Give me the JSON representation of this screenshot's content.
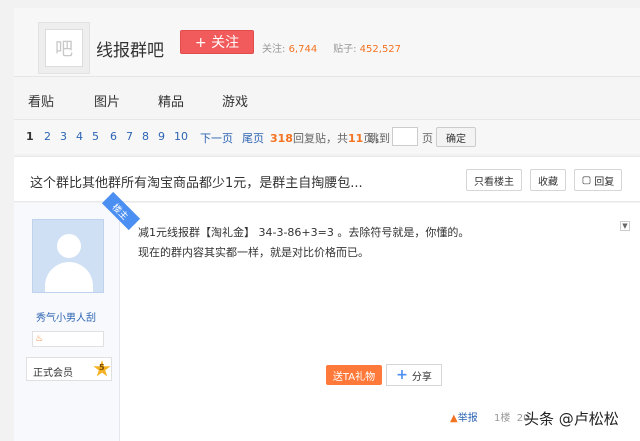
{
  "header": {
    "logo_char": "吧",
    "forum_name": "线报群吧",
    "follow_label": "+ 关注",
    "follow_label_text": "关注:",
    "follow_count": "6,744",
    "posts_label": "贴子:",
    "posts_count": "452,527"
  },
  "nav": {
    "items": [
      "看贴",
      "图片",
      "精品",
      "游戏"
    ]
  },
  "pager": {
    "pages": [
      "1",
      "2",
      "3",
      "4",
      "5",
      "6",
      "7",
      "8",
      "9",
      "10"
    ],
    "next": "下一页",
    "last": "尾页",
    "reply_count": "318",
    "reply_text": "回复贴，共",
    "page_count": "11",
    "page_unit": "页，",
    "jump_label": "跳到",
    "jump_unit": "页",
    "ok_label": "确定"
  },
  "thread": {
    "title": "这个群比其他群所有淘宝商品都少1元，是群主自掏腰包...",
    "only_op": "只看楼主",
    "favorite": "收藏",
    "reply": "回复"
  },
  "post": {
    "louzhu": "楼主",
    "username": "秀气小男人刮",
    "member_label": "正式会员",
    "level": "5",
    "line1": "减1元线报群【淘礼金】 34-3-86+3=3 。去除符号就是，你懂的。",
    "line2": "现在的群内容其实都一样，就是对比价格而已。",
    "gift_label": "送TA礼物",
    "share_label": "分享",
    "report_label": "举报",
    "floor_label": "1楼",
    "date_fragment": "20"
  },
  "watermark": "头条 @卢松松"
}
